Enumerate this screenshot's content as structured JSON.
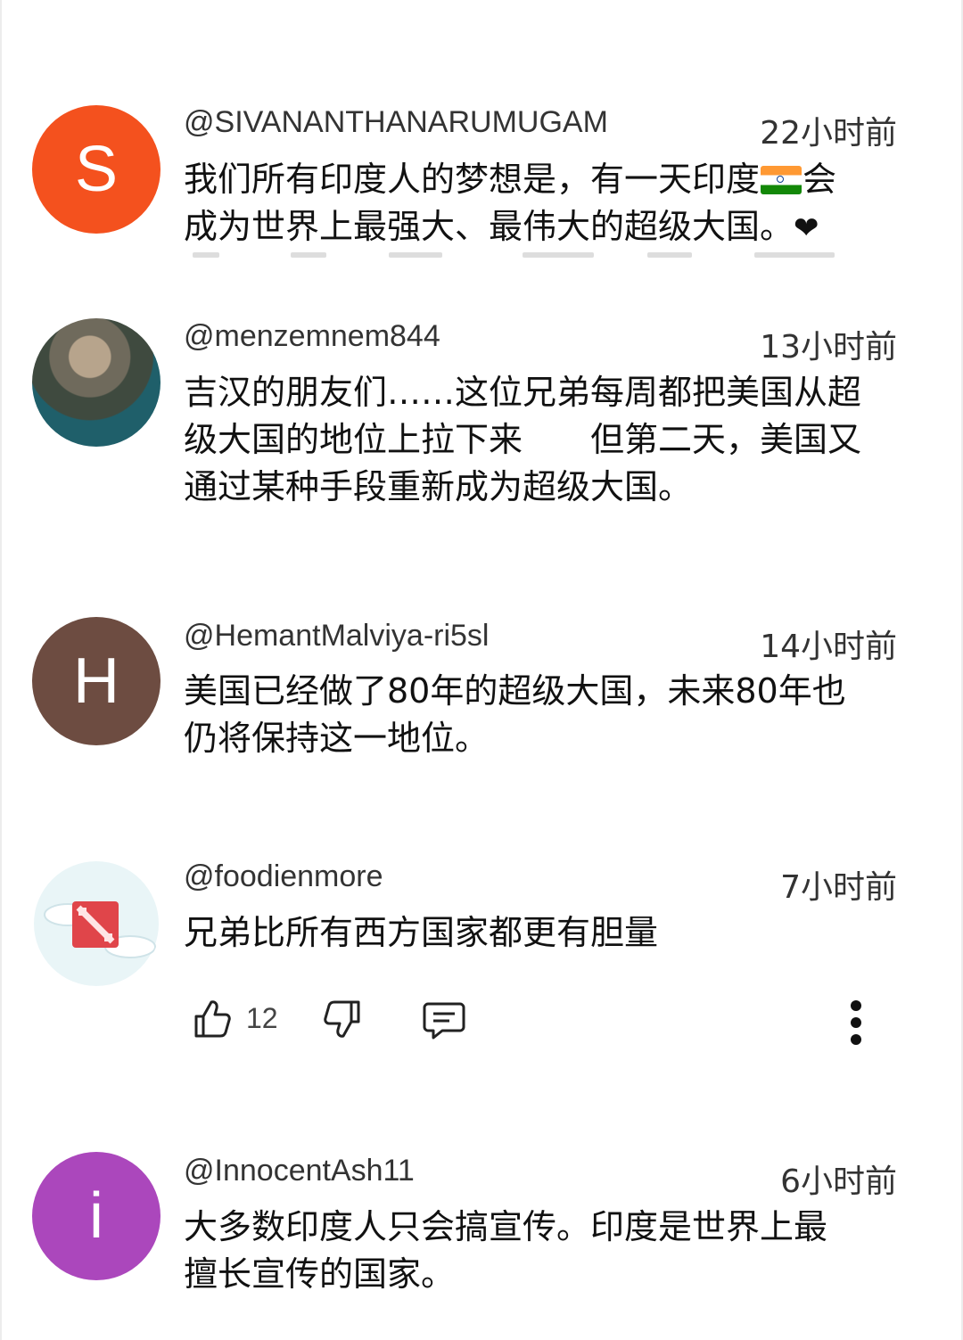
{
  "comments": [
    {
      "handle": "@SIVANANTHANARUMUGAM",
      "time": "22小时前",
      "avatar_letter": "S",
      "avatar_color": "#f4511e",
      "line1_before_flag": "我们所有印度人的梦想是，有一天印度",
      "line1_after_flag": "会",
      "line2": "成为世界上最强大、最伟大的超级大国。",
      "heart": "❤"
    },
    {
      "handle": "@menzemnem844",
      "time": "13小时前",
      "lines": [
        "吉汉的朋友们……这位兄弟每周都把美国从超",
        "级大国的地位上拉下来　　但第二天，美国又",
        "通过某种手段重新成为超级大国。"
      ]
    },
    {
      "handle": "@HemantMalviya-ri5sl",
      "time": "14小时前",
      "avatar_letter": "H",
      "avatar_color": "#6d4c41",
      "lines": [
        "美国已经做了80年的超级大国，未来80年也",
        "仍将保持这一地位。"
      ]
    },
    {
      "handle": "@foodienmore",
      "time": "7小时前",
      "lines": [
        "兄弟比所有西方国家都更有胆量"
      ],
      "actions": {
        "like_count": "12",
        "like_icon": "thumbs-up-icon",
        "dislike_icon": "thumbs-down-icon",
        "reply_icon": "comment-icon",
        "more_icon": "more-vertical-icon"
      }
    },
    {
      "handle": "@InnocentAsh11",
      "time": "6小时前",
      "avatar_letter": "i",
      "avatar_color": "#ab47bc",
      "lines": [
        "大多数印度人只会搞宣传。印度是世界上最",
        "擅长宣传的国家。"
      ]
    }
  ]
}
